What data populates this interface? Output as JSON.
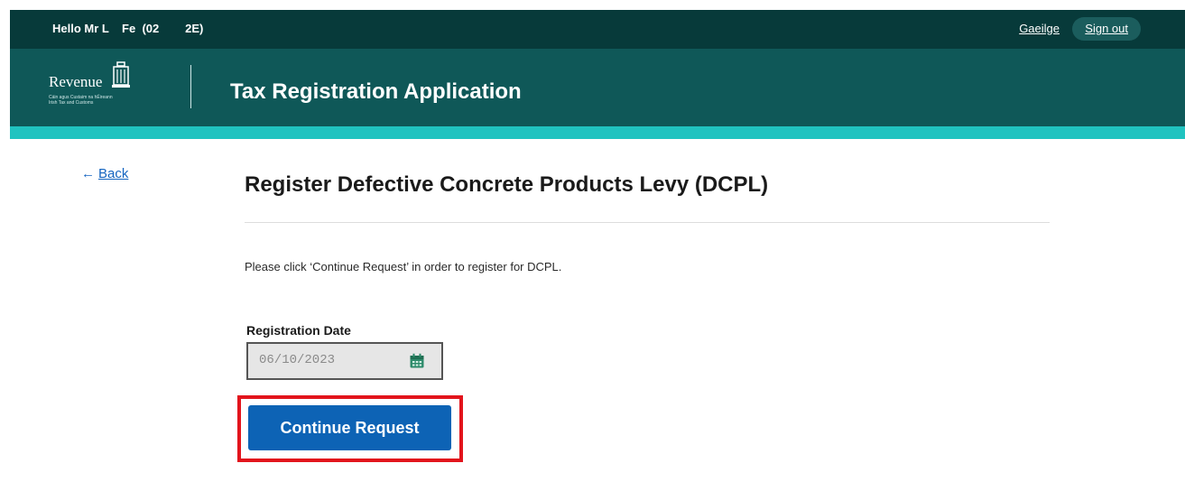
{
  "topbar": {
    "greeting": "Hello Mr L    Fe  (02        2E)",
    "language_link": "Gaeilge",
    "sign_out": "Sign out"
  },
  "header": {
    "logo_word": "Revenue",
    "logo_sub1": "Cáin agus Custaim na hÉireann",
    "logo_sub2": "Irish Tax and Customs",
    "app_title": "Tax Registration Application"
  },
  "nav": {
    "back_label": "Back"
  },
  "main": {
    "heading": "Register Defective Concrete Products Levy (DCPL)",
    "instruction": "Please click ‘Continue Request’ in order to register for DCPL.",
    "date_label": "Registration Date",
    "date_value": "06/10/2023",
    "continue_label": "Continue Request"
  },
  "colors": {
    "topbar": "#073a3a",
    "header": "#0f5858",
    "accent": "#20c3c0",
    "button": "#0d63b5",
    "highlight": "#e2141c"
  }
}
